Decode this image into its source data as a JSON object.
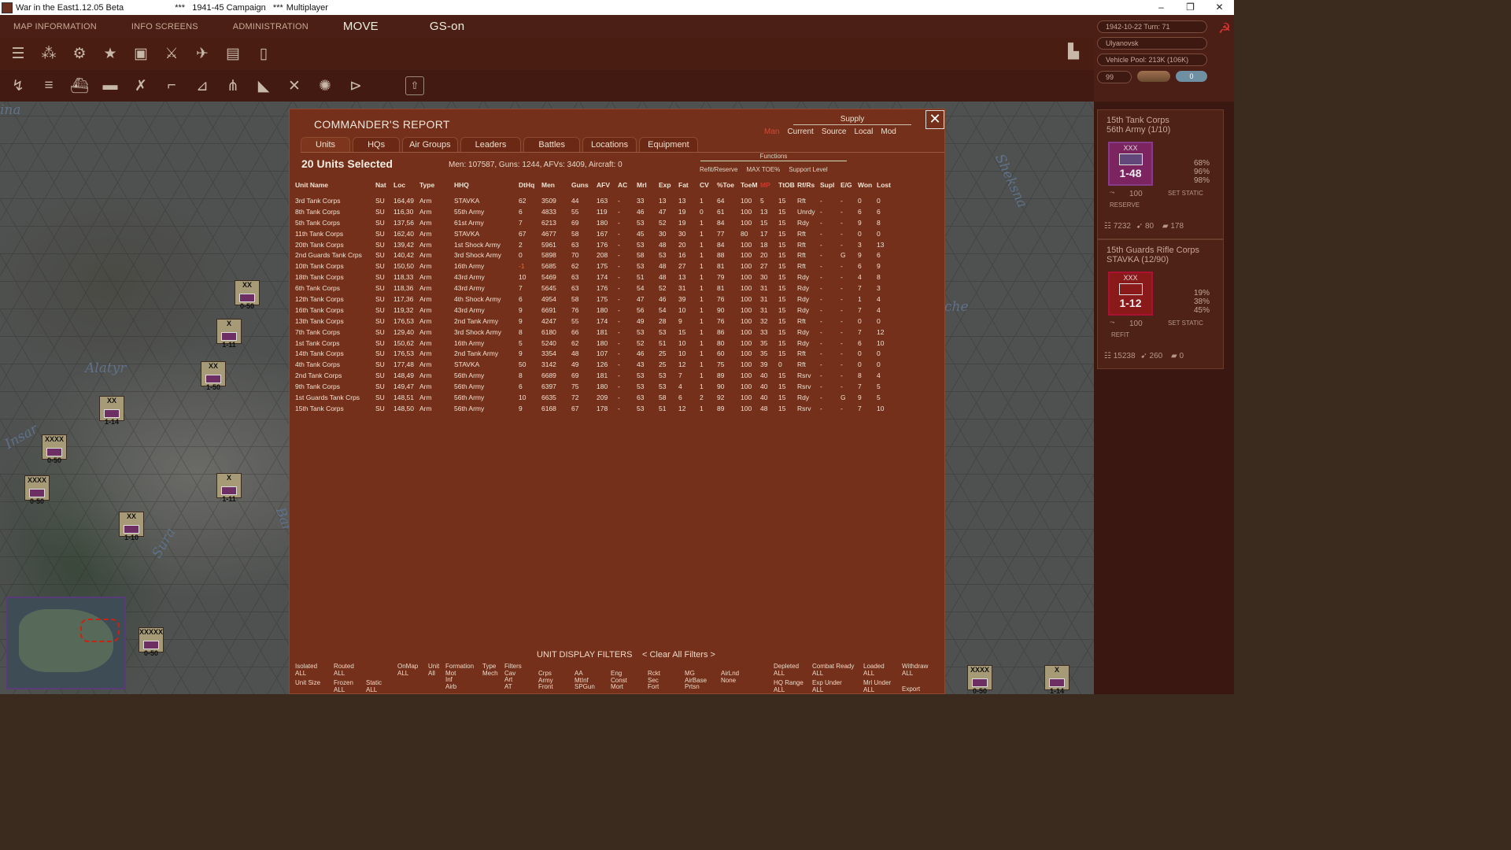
{
  "window": {
    "title": "War in the East1.12.05 Beta",
    "campaign": "***   1941-45 Campaign   ***",
    "mode": "Multiplayer",
    "minimize": "–",
    "restore": "❐",
    "close": "✕"
  },
  "menu": {
    "map_info": "MAP INFORMATION",
    "info_screens": "INFO SCREENS",
    "administration": "ADMINISTRATION",
    "move": "MOVE",
    "gs": "GS-on"
  },
  "toolbar1_icons": [
    "layers-icon",
    "units-icon",
    "gear-icon",
    "star-icon",
    "hq-icon",
    "crossed-swords-icon",
    "air-icon",
    "supply-icon",
    "fuel-icon"
  ],
  "toolbar2_icons": [
    "air-mission-icon",
    "bomber-icon",
    "ship-icon",
    "carrier-icon",
    "fighter-icon",
    "recon-icon",
    "transport-icon",
    "paradrop-icon",
    "interdict-icon",
    "attack-icon",
    "explosion-icon",
    "play-icon"
  ],
  "status": {
    "date_turn": "1942-10-22     Turn: 71",
    "location": "Ulyanovsk",
    "vehicle_pool": "Vehicle Pool: 213K (106K)",
    "counter": "99",
    "toggle": "0"
  },
  "map_labels": {
    "alatyr": "Alatyr",
    "insar": "Insar",
    "sura": "Sura",
    "bar": "Bar",
    "ina": "ina",
    "sheksna": "Sheksna",
    "che": "che"
  },
  "map_counters": [
    {
      "size": "XX",
      "val": "0-50"
    },
    {
      "size": "X",
      "val": "1-11"
    },
    {
      "size": "XX",
      "val": "1-50"
    },
    {
      "size": "XX",
      "val": "1-14"
    },
    {
      "size": "XXXX",
      "val": "0-50"
    },
    {
      "size": "XXXX",
      "val": "0-50"
    },
    {
      "size": "X",
      "val": "1-11"
    },
    {
      "size": "XX",
      "val": "1-10"
    },
    {
      "size": "XXXXX",
      "val": "0-50"
    },
    {
      "size": "XXXX",
      "val": "0-50"
    },
    {
      "size": "X",
      "val": "1-14"
    }
  ],
  "unit_panel": [
    {
      "name1": "15th Tank Corps",
      "name2": "56th Army (1/10)",
      "size": "XXX",
      "value": "1-48",
      "pct": [
        "68%",
        "96%",
        "98%"
      ],
      "mp": "100",
      "action": "SET STATIC",
      "status": "RESERVE",
      "men": "7232",
      "guns": "80",
      "afv": "178"
    },
    {
      "name1": "15th Guards Rifle Corps",
      "name2": "STAVKA (12/90)",
      "size": "XXX",
      "value": "1-12",
      "pct": [
        "19%",
        "38%",
        "45%"
      ],
      "mp": "100",
      "action": "SET STATIC",
      "status": "REFIT",
      "men": "15238",
      "guns": "260",
      "afv": "0"
    }
  ],
  "report": {
    "title": "COMMANDER'S REPORT",
    "close": "✕",
    "supply_header": "Supply",
    "supply_opts": [
      "Man",
      "Current",
      "Source",
      "Local",
      "Mod"
    ],
    "tabs": [
      "Units",
      "HQs",
      "Air Groups",
      "Leaders",
      "Battles",
      "Locations",
      "Equipment"
    ],
    "selected": "20 Units Selected",
    "summary": "Men: 107587, Guns: 1244, AFVs: 3409, Aircraft: 0",
    "functions_header": "Functions",
    "functions": [
      "Refit/Reserve",
      "MAX TOE%",
      "Support Level"
    ],
    "columns": [
      "Unit Name",
      "Nat",
      "Loc",
      "Type",
      "HHQ",
      "DtHq",
      "Men",
      "Guns",
      "AFV",
      "AC",
      "Mrl",
      "Exp",
      "Fat",
      "CV",
      "%Toe",
      "ToeM",
      "MP",
      "TtOB",
      "Rf/Rs",
      "Supl",
      "E/G",
      "Won",
      "Lost"
    ],
    "rows": [
      [
        "3rd Tank Corps",
        "SU",
        "164,49",
        "Arm",
        "STAVKA",
        "62",
        "3509",
        "44",
        "163",
        "-",
        "33",
        "13",
        "13",
        "1",
        "64",
        "100",
        "5",
        "15",
        "Rft",
        "-",
        "-",
        "0",
        "0"
      ],
      [
        "8th Tank Corps",
        "SU",
        "116,30",
        "Arm",
        "55th Army",
        "6",
        "4833",
        "55",
        "119",
        "-",
        "46",
        "47",
        "19",
        "0",
        "61",
        "100",
        "13",
        "15",
        "Unrdy",
        "-",
        "-",
        "6",
        "6"
      ],
      [
        "5th Tank Corps",
        "SU",
        "137,56",
        "Arm",
        "61st Army",
        "7",
        "6213",
        "69",
        "180",
        "-",
        "53",
        "52",
        "19",
        "1",
        "84",
        "100",
        "15",
        "15",
        "Rdy",
        "-",
        "-",
        "9",
        "8"
      ],
      [
        "11th Tank Corps",
        "SU",
        "162,40",
        "Arm",
        "STAVKA",
        "67",
        "4677",
        "58",
        "167",
        "-",
        "45",
        "30",
        "30",
        "1",
        "77",
        "80",
        "17",
        "15",
        "Rft",
        "-",
        "-",
        "0",
        "0"
      ],
      [
        "20th Tank Corps",
        "SU",
        "139,42",
        "Arm",
        "1st Shock Army",
        "2",
        "5961",
        "63",
        "176",
        "-",
        "53",
        "48",
        "20",
        "1",
        "84",
        "100",
        "18",
        "15",
        "Rft",
        "-",
        "-",
        "3",
        "13"
      ],
      [
        "2nd Guards Tank Crps",
        "SU",
        "140,42",
        "Arm",
        "3rd Shock Army",
        "0",
        "5898",
        "70",
        "208",
        "-",
        "58",
        "53",
        "16",
        "1",
        "88",
        "100",
        "20",
        "15",
        "Rft",
        "-",
        "G",
        "9",
        "6"
      ],
      [
        "10th Tank Corps",
        "SU",
        "150,50",
        "Arm",
        "16th Army",
        "-1",
        "5685",
        "62",
        "175",
        "-",
        "53",
        "48",
        "27",
        "1",
        "81",
        "100",
        "27",
        "15",
        "Rft",
        "-",
        "-",
        "6",
        "9"
      ],
      [
        "18th Tank Corps",
        "SU",
        "118,33",
        "Arm",
        "43rd Army",
        "10",
        "5469",
        "63",
        "174",
        "-",
        "51",
        "48",
        "13",
        "1",
        "79",
        "100",
        "30",
        "15",
        "Rdy",
        "-",
        "-",
        "4",
        "8"
      ],
      [
        "6th Tank Corps",
        "SU",
        "118,36",
        "Arm",
        "43rd Army",
        "7",
        "5645",
        "63",
        "176",
        "-",
        "54",
        "52",
        "31",
        "1",
        "81",
        "100",
        "31",
        "15",
        "Rdy",
        "-",
        "-",
        "7",
        "3"
      ],
      [
        "12th Tank Corps",
        "SU",
        "117,36",
        "Arm",
        "4th Shock Army",
        "6",
        "4954",
        "58",
        "175",
        "-",
        "47",
        "46",
        "39",
        "1",
        "76",
        "100",
        "31",
        "15",
        "Rdy",
        "-",
        "-",
        "1",
        "4"
      ],
      [
        "16th Tank Corps",
        "SU",
        "119,32",
        "Arm",
        "43rd Army",
        "9",
        "6691",
        "76",
        "180",
        "-",
        "56",
        "54",
        "10",
        "1",
        "90",
        "100",
        "31",
        "15",
        "Rdy",
        "-",
        "-",
        "7",
        "4"
      ],
      [
        "13th Tank Corps",
        "SU",
        "176,53",
        "Arm",
        "2nd Tank Army",
        "9",
        "4247",
        "55",
        "174",
        "-",
        "49",
        "28",
        "9",
        "1",
        "76",
        "100",
        "32",
        "15",
        "Rft",
        "-",
        "-",
        "0",
        "0"
      ],
      [
        "7th Tank Corps",
        "SU",
        "129,40",
        "Arm",
        "3rd Shock Army",
        "8",
        "6180",
        "66",
        "181",
        "-",
        "53",
        "53",
        "15",
        "1",
        "86",
        "100",
        "33",
        "15",
        "Rdy",
        "-",
        "-",
        "7",
        "12"
      ],
      [
        "1st Tank Corps",
        "SU",
        "150,62",
        "Arm",
        "16th Army",
        "5",
        "5240",
        "62",
        "180",
        "-",
        "52",
        "51",
        "10",
        "1",
        "80",
        "100",
        "35",
        "15",
        "Rdy",
        "-",
        "-",
        "6",
        "10"
      ],
      [
        "14th Tank Corps",
        "SU",
        "176,53",
        "Arm",
        "2nd Tank Army",
        "9",
        "3354",
        "48",
        "107",
        "-",
        "46",
        "25",
        "10",
        "1",
        "60",
        "100",
        "35",
        "15",
        "Rft",
        "-",
        "-",
        "0",
        "0"
      ],
      [
        "4th Tank Corps",
        "SU",
        "177,48",
        "Arm",
        "STAVKA",
        "50",
        "3142",
        "49",
        "126",
        "-",
        "43",
        "25",
        "12",
        "1",
        "75",
        "100",
        "39",
        "0",
        "Rft",
        "-",
        "-",
        "0",
        "0"
      ],
      [
        "2nd Tank Corps",
        "SU",
        "148,49",
        "Arm",
        "56th Army",
        "8",
        "6689",
        "69",
        "181",
        "-",
        "53",
        "53",
        "7",
        "1",
        "89",
        "100",
        "40",
        "15",
        "Rsrv",
        "-",
        "-",
        "8",
        "4"
      ],
      [
        "9th Tank Corps",
        "SU",
        "149,47",
        "Arm",
        "56th Army",
        "6",
        "6397",
        "75",
        "180",
        "-",
        "53",
        "53",
        "4",
        "1",
        "90",
        "100",
        "40",
        "15",
        "Rsrv",
        "-",
        "-",
        "7",
        "5"
      ],
      [
        "1st Guards Tank Crps",
        "SU",
        "148,51",
        "Arm",
        "56th Army",
        "10",
        "6635",
        "72",
        "209",
        "-",
        "63",
        "58",
        "6",
        "2",
        "92",
        "100",
        "40",
        "15",
        "Rdy",
        "-",
        "G",
        "9",
        "5"
      ],
      [
        "15th Tank Corps",
        "SU",
        "148,50",
        "Arm",
        "56th Army",
        "9",
        "6168",
        "67",
        "178",
        "-",
        "53",
        "51",
        "12",
        "1",
        "89",
        "100",
        "48",
        "15",
        "Rsrv",
        "-",
        "-",
        "7",
        "10"
      ]
    ],
    "filters_title": "UNIT DISPLAY FILTERS",
    "clear_filters": "< Clear All Filters >",
    "filters": {
      "isolated": "Isolated\nALL",
      "routed": "Routed\nALL",
      "onmap": "OnMap\nALL",
      "unit": "Unit\nAll",
      "formation": "Formation\nMot\nInf\nAirb",
      "type": "Type\nMech",
      "filters": "Filters\nCav\nArt\nAT",
      "crps": "Crps\nArmy\nFront",
      "aa": "AA\nMtInf\nSPGun",
      "eng": "Eng\nConst\nMort",
      "rckt": "Rckt\nSec\nFort",
      "mg": "MG\nAirBase\nPrtsn",
      "airlnd": "AirLnd\nNone",
      "unitsize": "Unit Size",
      "frozen": "Frozen\nALL",
      "static": "Static\nALL",
      "depleted": "Depleted\nALL",
      "combat_ready": "Combat Ready\nALL",
      "loaded": "Loaded\nALL",
      "withdraw": "Withdraw\nALL",
      "hqrange": "HQ Range\nALL",
      "expunder": "Exp Under\nALL",
      "mrlunder": "Mrl Under\nALL",
      "export": "Export"
    }
  }
}
